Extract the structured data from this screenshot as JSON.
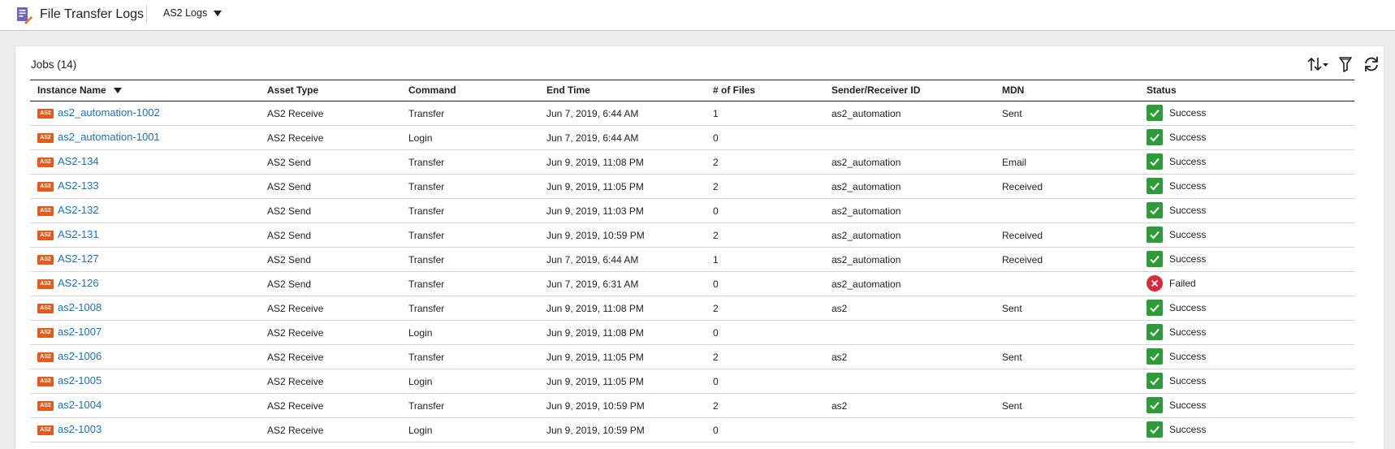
{
  "header": {
    "app_title": "File Transfer Logs",
    "log_selector": "AS2 Logs"
  },
  "jobs": {
    "title": "Jobs (14)",
    "columns": {
      "instance_name": "Instance Name",
      "asset_type": "Asset Type",
      "command": "Command",
      "end_time": "End Time",
      "files": "# of Files",
      "sender_receiver": "Sender/Receiver ID",
      "mdn": "MDN",
      "status": "Status"
    },
    "badge_label": "AS2",
    "rows": [
      {
        "name": "as2_automation-1002",
        "asset": "AS2 Receive",
        "cmd": "Transfer",
        "end": "Jun 7, 2019, 6:44 AM",
        "files": "1",
        "sr": "as2_automation",
        "mdn": "Sent",
        "status": "Success"
      },
      {
        "name": "as2_automation-1001",
        "asset": "AS2 Receive",
        "cmd": "Login",
        "end": "Jun 7, 2019, 6:44 AM",
        "files": "0",
        "sr": "",
        "mdn": "",
        "status": "Success"
      },
      {
        "name": "AS2-134",
        "asset": "AS2 Send",
        "cmd": "Transfer",
        "end": "Jun 9, 2019, 11:08 PM",
        "files": "2",
        "sr": "as2_automation",
        "mdn": "Email",
        "status": "Success"
      },
      {
        "name": "AS2-133",
        "asset": "AS2 Send",
        "cmd": "Transfer",
        "end": "Jun 9, 2019, 11:05 PM",
        "files": "2",
        "sr": "as2_automation",
        "mdn": "Received",
        "status": "Success"
      },
      {
        "name": "AS2-132",
        "asset": "AS2 Send",
        "cmd": "Transfer",
        "end": "Jun 9, 2019, 11:03 PM",
        "files": "0",
        "sr": "as2_automation",
        "mdn": "",
        "status": "Success"
      },
      {
        "name": "AS2-131",
        "asset": "AS2 Send",
        "cmd": "Transfer",
        "end": "Jun 9, 2019, 10:59 PM",
        "files": "2",
        "sr": "as2_automation",
        "mdn": "Received",
        "status": "Success"
      },
      {
        "name": "AS2-127",
        "asset": "AS2 Send",
        "cmd": "Transfer",
        "end": "Jun 7, 2019, 6:44 AM",
        "files": "1",
        "sr": "as2_automation",
        "mdn": "Received",
        "status": "Success"
      },
      {
        "name": "AS2-126",
        "asset": "AS2 Send",
        "cmd": "Transfer",
        "end": "Jun 7, 2019, 6:31 AM",
        "files": "0",
        "sr": "as2_automation",
        "mdn": "",
        "status": "Failed"
      },
      {
        "name": "as2-1008",
        "asset": "AS2 Receive",
        "cmd": "Transfer",
        "end": "Jun 9, 2019, 11:08 PM",
        "files": "2",
        "sr": "as2",
        "mdn": "Sent",
        "status": "Success"
      },
      {
        "name": "as2-1007",
        "asset": "AS2 Receive",
        "cmd": "Login",
        "end": "Jun 9, 2019, 11:08 PM",
        "files": "0",
        "sr": "",
        "mdn": "",
        "status": "Success"
      },
      {
        "name": "as2-1006",
        "asset": "AS2 Receive",
        "cmd": "Transfer",
        "end": "Jun 9, 2019, 11:05 PM",
        "files": "2",
        "sr": "as2",
        "mdn": "Sent",
        "status": "Success"
      },
      {
        "name": "as2-1005",
        "asset": "AS2 Receive",
        "cmd": "Login",
        "end": "Jun 9, 2019, 11:05 PM",
        "files": "0",
        "sr": "",
        "mdn": "",
        "status": "Success"
      },
      {
        "name": "as2-1004",
        "asset": "AS2 Receive",
        "cmd": "Transfer",
        "end": "Jun 9, 2019, 10:59 PM",
        "files": "2",
        "sr": "as2",
        "mdn": "Sent",
        "status": "Success"
      },
      {
        "name": "as2-1003",
        "asset": "AS2 Receive",
        "cmd": "Login",
        "end": "Jun 9, 2019, 10:59 PM",
        "files": "0",
        "sr": "",
        "mdn": "",
        "status": "Success"
      }
    ]
  },
  "toolbar_icons": [
    "sort-icon",
    "filter-icon",
    "refresh-icon"
  ],
  "colors": {
    "link": "#1c72c4",
    "badge": "#e35b1d",
    "success": "#2e9b39",
    "failed": "#d82a3c"
  }
}
